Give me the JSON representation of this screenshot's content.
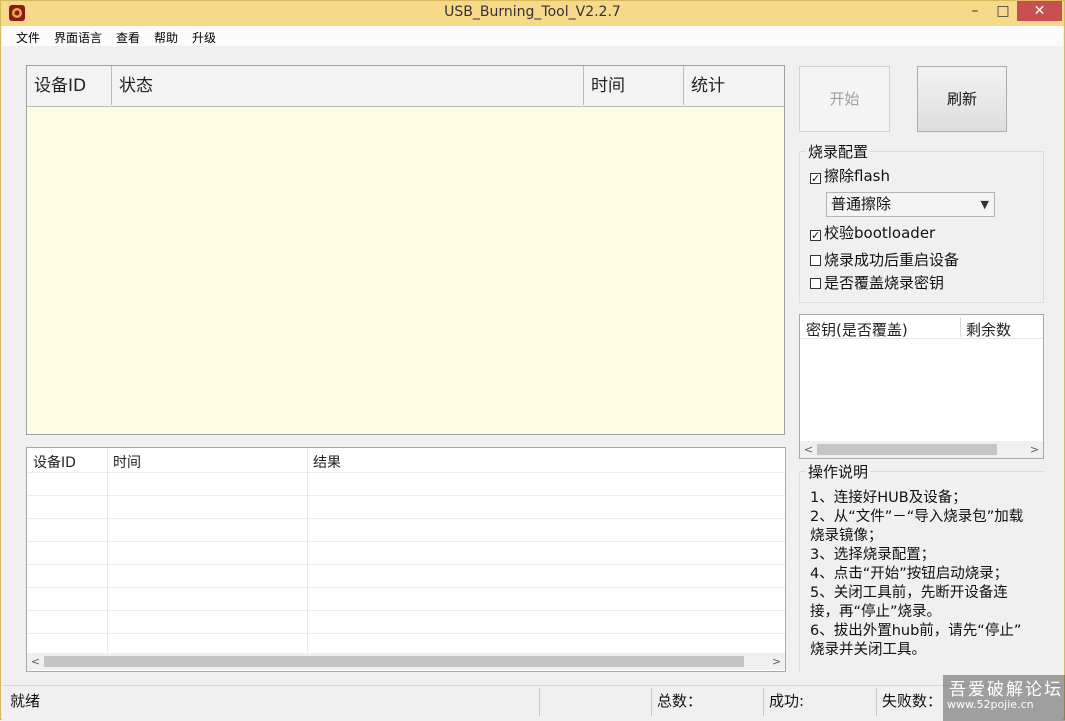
{
  "titlebar": {
    "title": "USB_Burning_Tool_V2.2.7",
    "minimize": "–",
    "maximize": "□",
    "close": "✕"
  },
  "menu": [
    "文件",
    "界面语言",
    "查看",
    "帮助",
    "升级"
  ],
  "device_list": {
    "columns": [
      "设备ID",
      "状态",
      "时间",
      "统计"
    ]
  },
  "log_list": {
    "columns": [
      "设备ID",
      "时间",
      "结果"
    ]
  },
  "buttons": {
    "start": "开始",
    "refresh": "刷新"
  },
  "burn_config": {
    "title": "烧录配置",
    "erase_flash": {
      "label": "擦除flash",
      "checked": true
    },
    "erase_mode": "普通擦除",
    "verify_bootloader": {
      "label": "校验bootloader",
      "checked": true
    },
    "reboot_after": {
      "label": "烧录成功后重启设备",
      "checked": false
    },
    "overwrite_key": {
      "label": "是否覆盖烧录密钥",
      "checked": false
    }
  },
  "key_list": {
    "columns": [
      "密钥(是否覆盖)",
      "剩余数"
    ]
  },
  "instructions": {
    "title": "操作说明",
    "lines": [
      "1、连接好HUB及设备；",
      "2、从“文件”－“导入烧录包”加载",
      "烧录镜像；",
      "3、选择烧录配置；",
      "4、点击“开始”按钮启动烧录；",
      "5、关闭工具前，先断开设备连",
      "接，再“停止”烧录。",
      "6、拔出外置hub前，请先“停止”",
      "烧录并关闭工具。"
    ]
  },
  "statusbar": {
    "status": "就绪",
    "total": "总数：",
    "success": "成功:",
    "failed": "失败数："
  },
  "watermark": {
    "main": "吾爱破解论坛",
    "sub": "www.52pojie.cn"
  },
  "colors": {
    "titlebar": "#f7d98a",
    "device_list_bg": "#fffde1",
    "close_button": "#c74f4f"
  }
}
